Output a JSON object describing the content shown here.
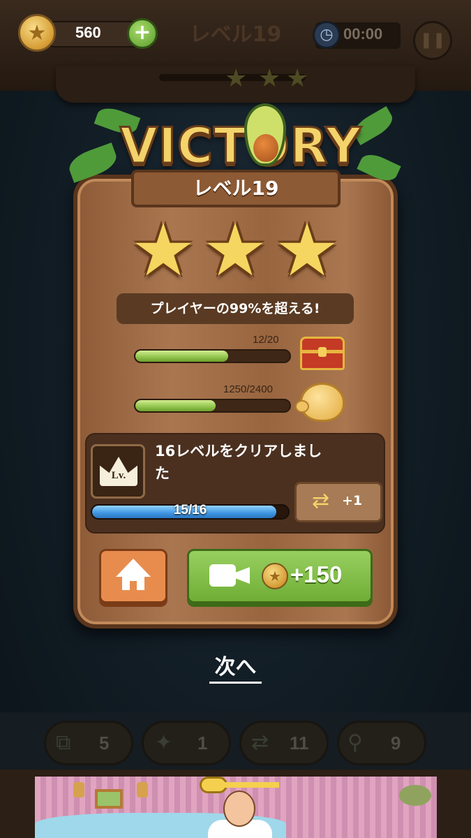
{
  "top_bar": {
    "coins": "560",
    "level_title": "レベル19",
    "timer": "00:00",
    "level_stars": 3
  },
  "victory": {
    "banner": "VICTORY",
    "level_label": "レベル19",
    "stars_earned": 3,
    "rank_text": "プレイヤーの99%を超える!",
    "chest_progress": {
      "label": "12/20",
      "fraction": 0.6
    },
    "piggy_progress": {
      "label": "1250/2400",
      "fraction": 0.52
    },
    "level_reward": {
      "message": "16レベルをクリアしました",
      "badge_text": "Lv.",
      "progress_label": "15/16",
      "fraction": 0.94,
      "reward_amount": "+1"
    },
    "ad_reward": "+150",
    "next_label": "次へ"
  },
  "boosters": [
    {
      "icon": "image-swap-icon",
      "count": "5"
    },
    {
      "icon": "magic-wand-icon",
      "count": "1"
    },
    {
      "icon": "shuffle-icon",
      "count": "11"
    },
    {
      "icon": "magnifier-icon",
      "count": "9"
    }
  ],
  "colors": {
    "accent_green": "#6fae36",
    "accent_orange": "#e88c4e",
    "wood": "#a97650",
    "star_gold": "#f5d660",
    "progress_blue": "#3e95e0"
  }
}
